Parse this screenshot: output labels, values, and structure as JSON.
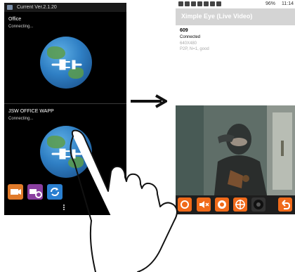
{
  "left_screen": {
    "status_title": "Current Ver.2.1.20",
    "cameras": [
      {
        "name": "Office",
        "status": "Connecting..."
      },
      {
        "name": "JSW OFFICE WAPP",
        "status": "Connecting..."
      }
    ],
    "bottom_buttons": [
      "add-camera-icon",
      "camera-settings-icon",
      "refresh-icon"
    ]
  },
  "right_screen": {
    "status_signal": "96%",
    "status_time": "11:14",
    "title": "Ximple Eye (Live Video)",
    "camera_id": "609",
    "connection": "Connected",
    "resolution": "640X480",
    "p2p_info": "P2P, N=1, good",
    "controls": [
      "snapshot-icon",
      "mute-icon",
      "record-icon",
      "ptz-icon",
      "talk-icon",
      "back-icon"
    ]
  },
  "colors": {
    "accent_orange": "#f06a1a",
    "title_bar": "#d4d4d4",
    "globe_blue": "#2f7fc4"
  }
}
